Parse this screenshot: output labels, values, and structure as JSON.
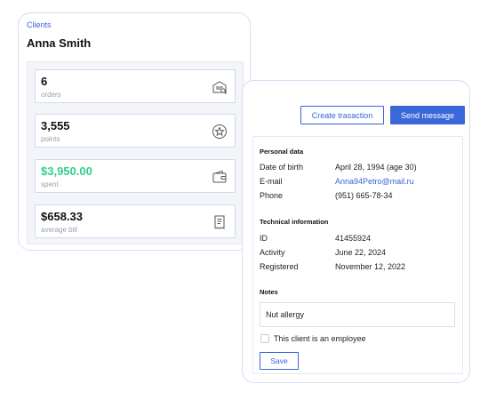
{
  "client_card": {
    "breadcrumb": "Clients",
    "name": "Anna Smith",
    "stats": [
      {
        "value": "6",
        "caption": "orders",
        "icon": "orders-icon"
      },
      {
        "value": "3,555",
        "caption": "points",
        "icon": "star-badge-icon"
      },
      {
        "value": "$3,950.00",
        "caption": "spent",
        "icon": "wallet-icon",
        "color": "#2fd08f"
      },
      {
        "value": "$658.33",
        "caption": "average bill",
        "icon": "receipt-icon"
      }
    ]
  },
  "actions": {
    "create_transaction": "Create trasaction",
    "send_message": "Send message"
  },
  "personal": {
    "title": "Personal data",
    "rows": [
      {
        "label": "Date of birth",
        "value": "April 28, 1994 (age 30)"
      },
      {
        "label": "E-mail",
        "value": "Anna94Petro@mail.ru"
      },
      {
        "label": "Phone",
        "value": "(951) 665-78-34"
      }
    ]
  },
  "technical": {
    "title": "Technical information",
    "rows": [
      {
        "label": "ID",
        "value": "41455924"
      },
      {
        "label": "Activity",
        "value": "June 22, 2024"
      },
      {
        "label": "Registered",
        "value": "November 12, 2022"
      }
    ]
  },
  "notes": {
    "title": "Notes",
    "text": "Nut allergy",
    "employee_checkbox_label": "This client is an employee",
    "employee_checked": false,
    "save_label": "Save"
  },
  "colors": {
    "accent": "#3b68d9",
    "positive": "#2fd08f"
  }
}
